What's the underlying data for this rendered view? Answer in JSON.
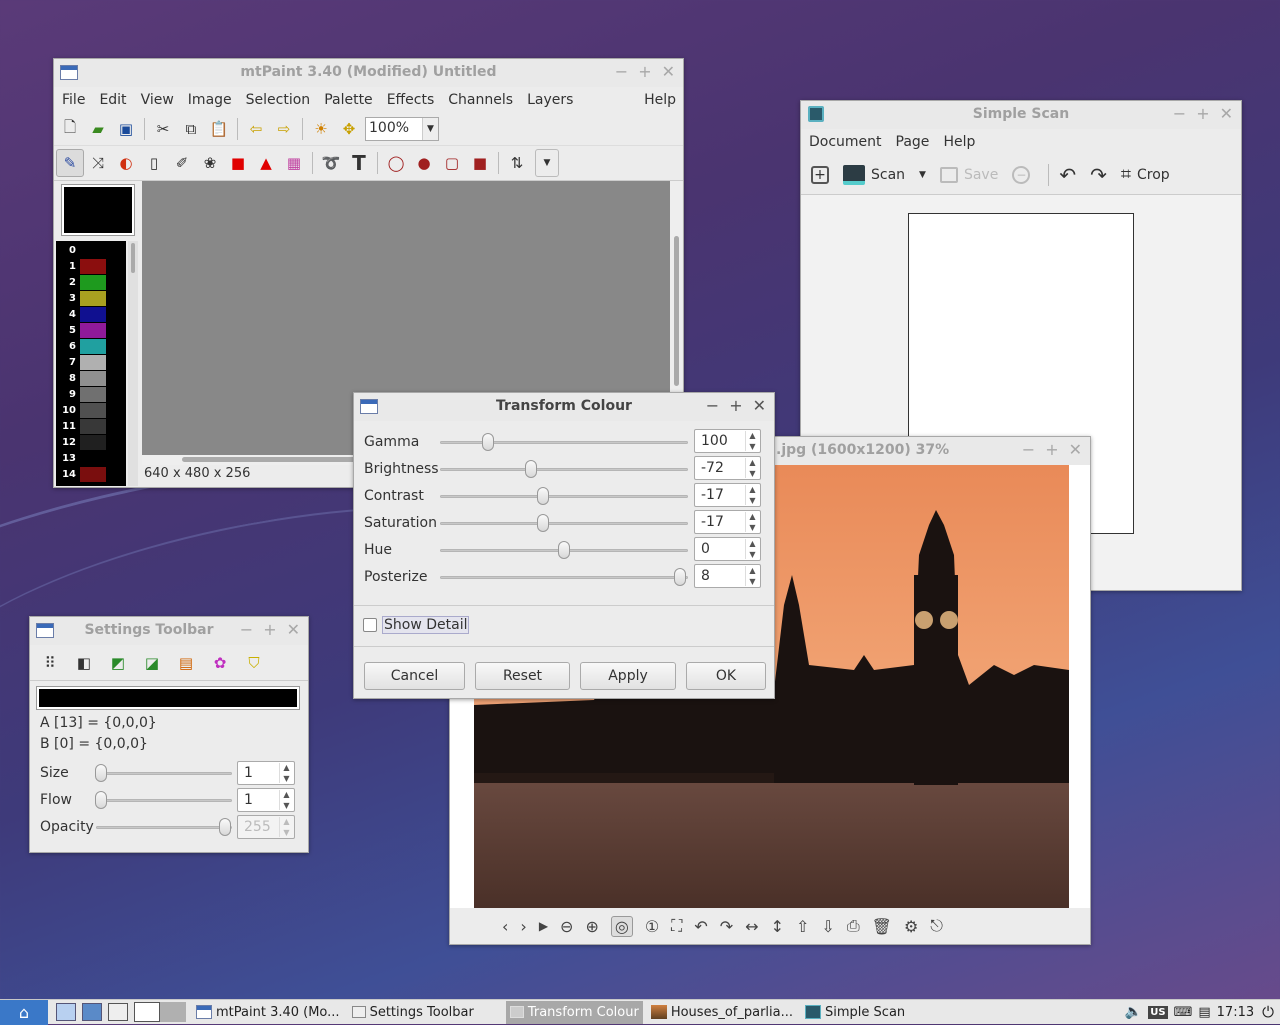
{
  "mtpaint": {
    "title": "mtPaint 3.40 (Modified) Untitled",
    "menu": [
      "File",
      "Edit",
      "View",
      "Image",
      "Selection",
      "Palette",
      "Effects",
      "Channels",
      "Layers"
    ],
    "help": "Help",
    "zoom": "100%",
    "status": "640 x 480 x 256",
    "palette": [
      {
        "n": "0",
        "c": "#000000"
      },
      {
        "n": "1",
        "c": "#8b0e0e"
      },
      {
        "n": "2",
        "c": "#1e9a1e"
      },
      {
        "n": "3",
        "c": "#a8a020"
      },
      {
        "n": "4",
        "c": "#101090"
      },
      {
        "n": "5",
        "c": "#901a9a"
      },
      {
        "n": "6",
        "c": "#20a0a0"
      },
      {
        "n": "7",
        "c": "#b0b0b0"
      },
      {
        "n": "8",
        "c": "#909090"
      },
      {
        "n": "9",
        "c": "#707070"
      },
      {
        "n": "10",
        "c": "#505050"
      },
      {
        "n": "11",
        "c": "#383838"
      },
      {
        "n": "12",
        "c": "#202020"
      },
      {
        "n": "13",
        "c": "#000000"
      },
      {
        "n": "14",
        "c": "#7a0e0e"
      }
    ]
  },
  "transform": {
    "title": "Transform Colour",
    "rows": [
      {
        "label": "Gamma",
        "value": "100",
        "level": 0.18
      },
      {
        "label": "Brightness",
        "value": "-72",
        "level": 0.36
      },
      {
        "label": "Contrast",
        "value": "-17",
        "level": 0.41
      },
      {
        "label": "Saturation",
        "value": "-17",
        "level": 0.41
      },
      {
        "label": "Hue",
        "value": "0",
        "level": 0.5
      },
      {
        "label": "Posterize",
        "value": "8",
        "level": 0.99
      }
    ],
    "show_detail": "Show Detail",
    "buttons": {
      "cancel": "Cancel",
      "reset": "Reset",
      "apply": "Apply",
      "ok": "OK"
    }
  },
  "settings": {
    "title": "Settings Toolbar",
    "a": "A [13] = {0,0,0}",
    "b": "B [0] = {0,0,0}",
    "size_label": "Size",
    "size": "1",
    "flow_label": "Flow",
    "flow": "1",
    "opacity_label": "Opacity",
    "opacity": "255"
  },
  "simplescan": {
    "title": "Simple Scan",
    "menu": [
      "Document",
      "Page",
      "Help"
    ],
    "scan": "Scan",
    "save": "Save",
    "crop": "Crop"
  },
  "viewer": {
    "title": ".jpg (1600x1200) 37%"
  },
  "taskbar": {
    "tasks": [
      "mtPaint 3.40 (Mo...",
      "Settings Toolbar",
      "Transform Colour",
      "Houses_of_parlia...",
      "Simple Scan"
    ],
    "kbd": "US",
    "clock": "17:13"
  }
}
